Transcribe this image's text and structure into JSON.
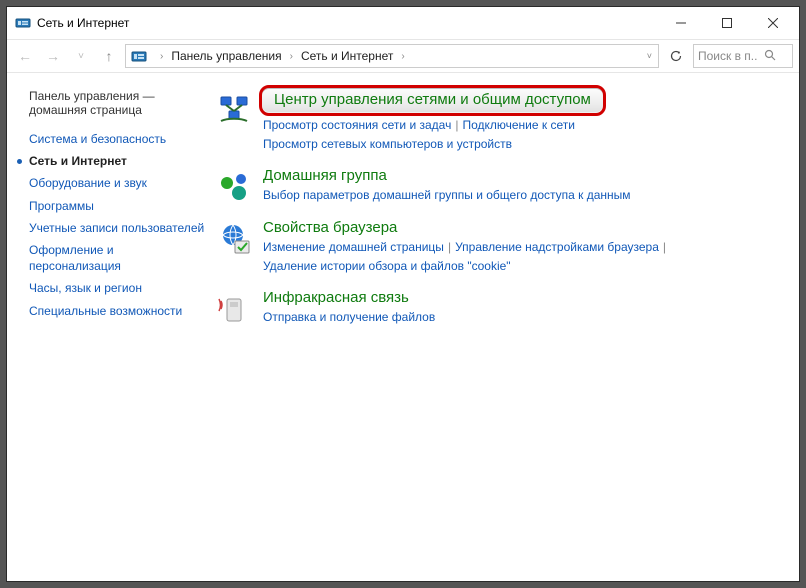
{
  "titlebar": {
    "title": "Сеть и Интернет"
  },
  "toolbar": {
    "breadcrumb": [
      "Панель управления",
      "Сеть и Интернет"
    ],
    "search_placeholder": "Поиск в п..."
  },
  "sidebar": {
    "home_line1": "Панель управления —",
    "home_line2": "домашняя страница",
    "items": [
      {
        "label": "Система и безопасность",
        "active": false
      },
      {
        "label": "Сеть и Интернет",
        "active": true
      },
      {
        "label": "Оборудование и звук",
        "active": false
      },
      {
        "label": "Программы",
        "active": false
      },
      {
        "label": "Учетные записи пользователей",
        "active": false
      },
      {
        "label": "Оформление и персонализация",
        "active": false
      },
      {
        "label": "Часы, язык и регион",
        "active": false
      },
      {
        "label": "Специальные возможности",
        "active": false
      }
    ]
  },
  "main": {
    "categories": [
      {
        "title": "Центр управления сетями и общим доступом",
        "highlighted": true,
        "links": [
          {
            "label": "Просмотр состояния сети и задач",
            "struck": true
          },
          {
            "label": "Подключение к сети",
            "struck": true
          },
          {
            "label": "Просмотр сетевых компьютеров и устройств",
            "struck": false
          }
        ]
      },
      {
        "title": "Домашняя группа",
        "highlighted": false,
        "links": [
          {
            "label": "Выбор параметров домашней группы и общего доступа к данным",
            "struck": false
          }
        ]
      },
      {
        "title": "Свойства браузера",
        "highlighted": false,
        "links": [
          {
            "label": "Изменение домашней страницы",
            "struck": false
          },
          {
            "label": "Управление надстройками браузера",
            "struck": false
          },
          {
            "label": "Удаление истории обзора и файлов \"cookie\"",
            "struck": false
          }
        ]
      },
      {
        "title": "Инфракрасная связь",
        "highlighted": false,
        "links": [
          {
            "label": "Отправка и получение файлов",
            "struck": false
          }
        ]
      }
    ]
  }
}
